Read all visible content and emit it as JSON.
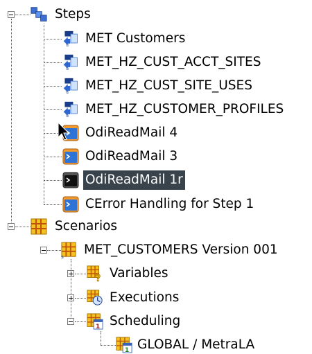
{
  "tree": {
    "steps": {
      "label": "Steps",
      "children": [
        {
          "label": "MET Customers",
          "icon": "interface-icon"
        },
        {
          "label": "MET_HZ_CUST_ACCT_SITES",
          "icon": "interface-icon"
        },
        {
          "label": "MET_HZ_CUST_SITE_USES",
          "icon": "interface-icon"
        },
        {
          "label": "MET_HZ_CUSTOMER_PROFILES",
          "icon": "interface-icon"
        },
        {
          "label": "OdiReadMail 4",
          "icon": "odi-tool-icon"
        },
        {
          "label": "OdiReadMail 3",
          "icon": "odi-tool-icon"
        },
        {
          "label": "OdiReadMail 1r",
          "icon": "odi-tool-icon",
          "selected": true
        },
        {
          "label": "CError Handling for Step 1",
          "icon": "odi-tool-icon"
        }
      ]
    },
    "scenarios": {
      "label": "Scenarios",
      "scenario": {
        "label": "MET_CUSTOMERS Version 001",
        "children": {
          "variables": "Variables",
          "executions": "Executions",
          "scheduling": "Scheduling",
          "schedule_item": "GLOBAL / MetraLA"
        }
      }
    }
  }
}
